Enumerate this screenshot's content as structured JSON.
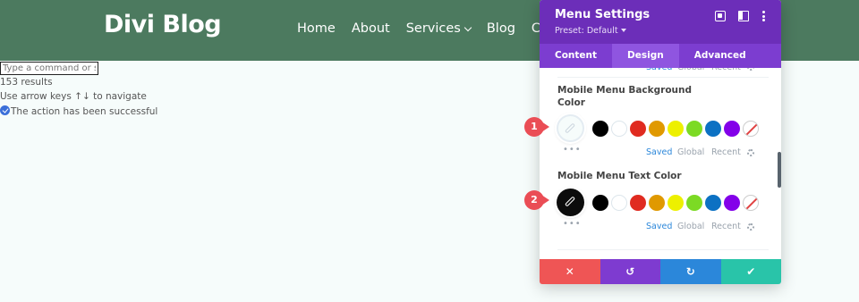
{
  "site": {
    "logo": "Divi Blog",
    "nav": [
      "Home",
      "About",
      "Services",
      "Blog",
      "Cont"
    ]
  },
  "palette": {
    "placeholder": "Type a command or search",
    "results": "153 results",
    "hint": "Use arrow keys ↑↓ to navigate",
    "success": "The action has been successful"
  },
  "panel": {
    "title": "Menu Settings",
    "preset": "Preset: Default",
    "tabs": [
      "Content",
      "Design",
      "Advanced"
    ],
    "active_tab": "Design",
    "preset_tabs": [
      "Saved",
      "Global",
      "Recent"
    ],
    "fields": [
      {
        "label": "Mobile Menu Background Color",
        "selected_color": "#f6fcfb",
        "badge": "1"
      },
      {
        "label": "Mobile Menu Text Color",
        "selected_color": "#0c0c0c",
        "badge": "2"
      }
    ],
    "swatch_colors": [
      "#000000",
      "#ffffff",
      "#e02b20",
      "#e09900",
      "#edf000",
      "#7cda24",
      "#0c71c3",
      "#8300e9"
    ],
    "footer": {
      "colors": [
        "#ef5555",
        "#7e3bd0",
        "#2b87da",
        "#29c4a9"
      ],
      "icons": [
        "close-icon",
        "undo-icon",
        "redo-icon",
        "check-icon"
      ]
    }
  },
  "colors": {
    "header_bg": "#4c7a5f",
    "panel_head": "#6c2eb9",
    "panel_tabs": "#7c3dd0",
    "badge": "#ea4d55"
  }
}
